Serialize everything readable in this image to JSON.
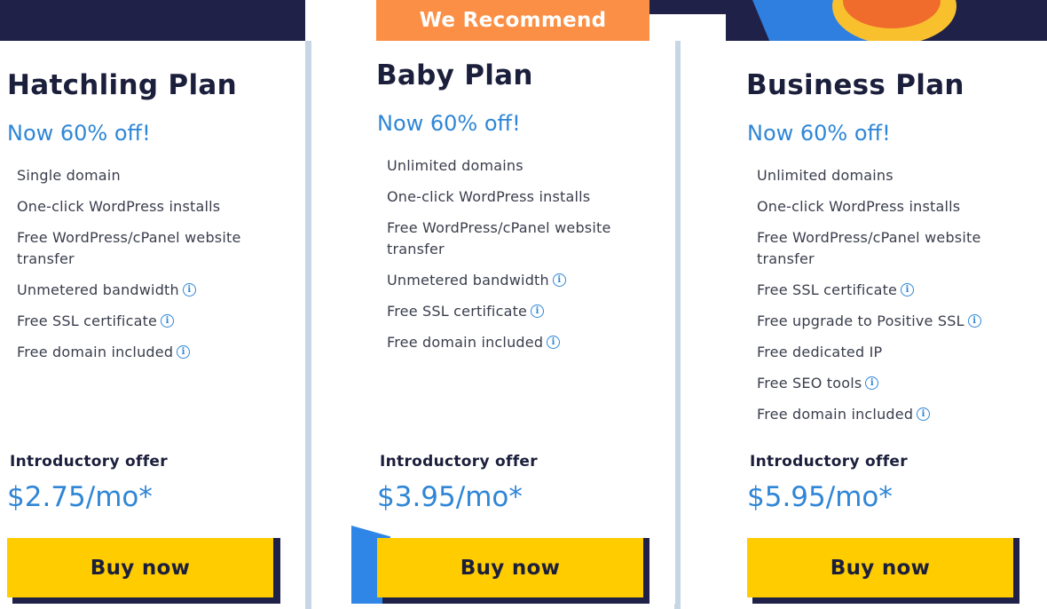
{
  "banner": {
    "recommend_label": "We Recommend"
  },
  "plans": [
    {
      "title": "Hatchling Plan",
      "promo": "Now 60% off!",
      "features": [
        {
          "text": "Single domain",
          "info": false
        },
        {
          "text": "One-click WordPress installs",
          "info": false
        },
        {
          "text": "Free WordPress/cPanel website transfer",
          "info": false
        },
        {
          "text": "Unmetered bandwidth",
          "info": true
        },
        {
          "text": "Free SSL certificate",
          "info": true
        },
        {
          "text": "Free domain included",
          "info": true
        }
      ],
      "intro_label": "Introductory offer",
      "price": "$2.75/mo*",
      "button_label": "Buy now"
    },
    {
      "title": "Baby Plan",
      "promo": "Now 60% off!",
      "features": [
        {
          "text": "Unlimited domains",
          "info": false
        },
        {
          "text": "One-click WordPress installs",
          "info": false
        },
        {
          "text": "Free WordPress/cPanel website transfer",
          "info": false
        },
        {
          "text": "Unmetered bandwidth",
          "info": true
        },
        {
          "text": "Free SSL certificate",
          "info": true
        },
        {
          "text": "Free domain included",
          "info": true
        }
      ],
      "intro_label": "Introductory offer",
      "price": "$3.95/mo*",
      "button_label": "Buy now"
    },
    {
      "title": "Business Plan",
      "promo": "Now 60% off!",
      "features": [
        {
          "text": "Unlimited domains",
          "info": false
        },
        {
          "text": "One-click WordPress installs",
          "info": false
        },
        {
          "text": "Free WordPress/cPanel website transfer",
          "info": false
        },
        {
          "text": "Free SSL certificate",
          "info": true
        },
        {
          "text": "Free upgrade to Positive SSL",
          "info": true
        },
        {
          "text": "Free dedicated IP",
          "info": false
        },
        {
          "text": "Free SEO tools",
          "info": true
        },
        {
          "text": "Free domain included",
          "info": true
        }
      ],
      "intro_label": "Introductory offer",
      "price": "$5.95/mo*",
      "button_label": "Buy now"
    }
  ],
  "colors": {
    "navy": "#1f2148",
    "accent_blue": "#2f86d6",
    "button_yellow": "#ffcc00",
    "recommend_orange": "#fa8f45"
  },
  "icons": {
    "info": "info-circle-icon"
  }
}
